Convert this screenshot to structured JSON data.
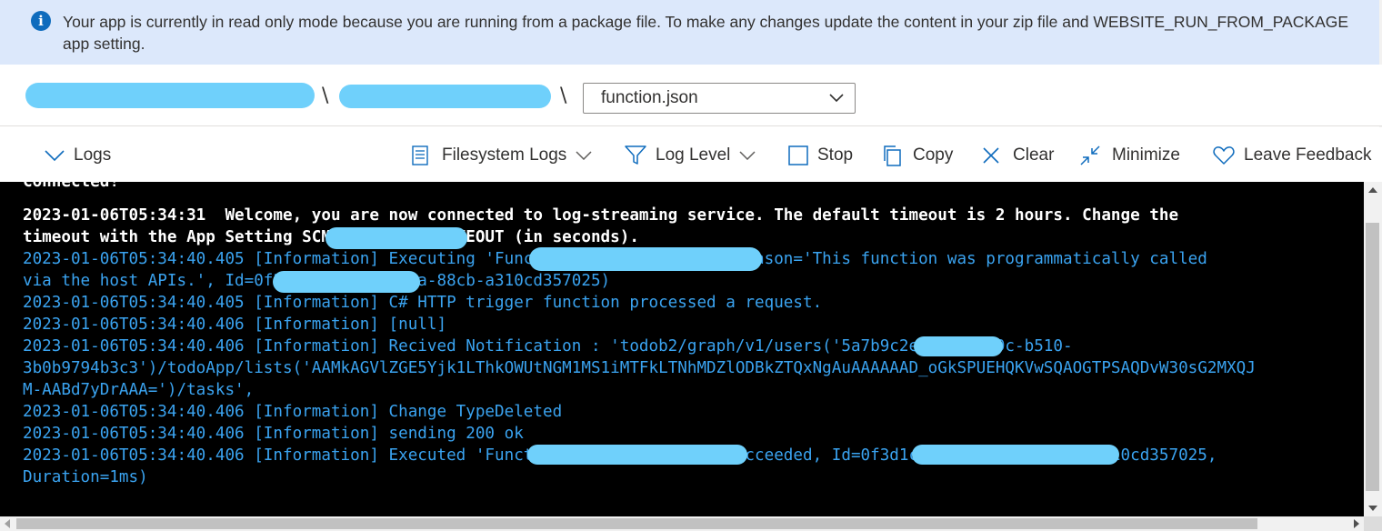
{
  "banner": {
    "icon": "info-icon",
    "text": "Your app is currently in read only mode because you are running from a package file. To make any changes update the content in your zip file and WEBSITE_RUN_FROM_PACKAGE app setting."
  },
  "breadcrumb": {
    "separator": "\\",
    "file_select_value": "function.json"
  },
  "toolbar": {
    "logs_label": "Logs",
    "filesystem_logs_label": "Filesystem Logs",
    "log_level_label": "Log Level",
    "stop_label": "Stop",
    "copy_label": "Copy",
    "clear_label": "Clear",
    "minimize_label": "Minimize",
    "leave_feedback_label": "Leave Feedback"
  },
  "console": {
    "connected": "Connected!",
    "lines": [
      {
        "style": "w",
        "text": "2023-01-06T05:34:31  Welcome, you are now connected to log-streaming service. The default timeout is 2 hours. Change the"
      },
      {
        "style": "w",
        "text": "timeout with the App Setting SCM_LOGSTREAM_TIMEOUT (in seconds)."
      },
      {
        "style": "b",
        "text": "2023-01-06T05:34:40.405 [Information] Executing 'Functions.GraphWebhook' (Reason='This function was programmatically called"
      },
      {
        "style": "b",
        "text": "via the host APIs.', Id=0f3d1c2a-5b7e-4e6a-88cb-a310cd357025)"
      },
      {
        "style": "b",
        "text": "2023-01-06T05:34:40.405 [Information] C# HTTP trigger function processed a request."
      },
      {
        "style": "b",
        "text": "2023-01-06T05:34:40.406 [Information] [null]"
      },
      {
        "style": "b",
        "text": "2023-01-06T05:34:40.406 [Information] Recived Notification : 'todob2/graph/v1/users('5a7b9c2e-cbed-479c-b510-"
      },
      {
        "style": "b",
        "text": "3b0b9794b3c3')/todoApp/lists('AAMkAGVlZGE5Yjk1LThkOWUtNGM1MS1iMTFkLTNhMDZlODBkZTQxNgAuAAAAAAD_oGkSPUEHQKVwSQAOGTPSAQDvW30sG2MXQJ"
      },
      {
        "style": "b",
        "text": "M-AABd7yDrAAA=')/tasks',"
      },
      {
        "style": "b",
        "text": "2023-01-06T05:34:40.406 [Information] Change TypeDeleted"
      },
      {
        "style": "b",
        "text": "2023-01-06T05:34:40.406 [Information] sending 200 ok"
      },
      {
        "style": "b",
        "text": "2023-01-06T05:34:40.406 [Information] Executed 'Functions.GraphWebhook' (Succeeded, Id=0f3d1c2a-5b7e-4e6a-88cb-a310cd357025,"
      },
      {
        "style": "b",
        "text": "Duration=1ms)"
      }
    ]
  }
}
